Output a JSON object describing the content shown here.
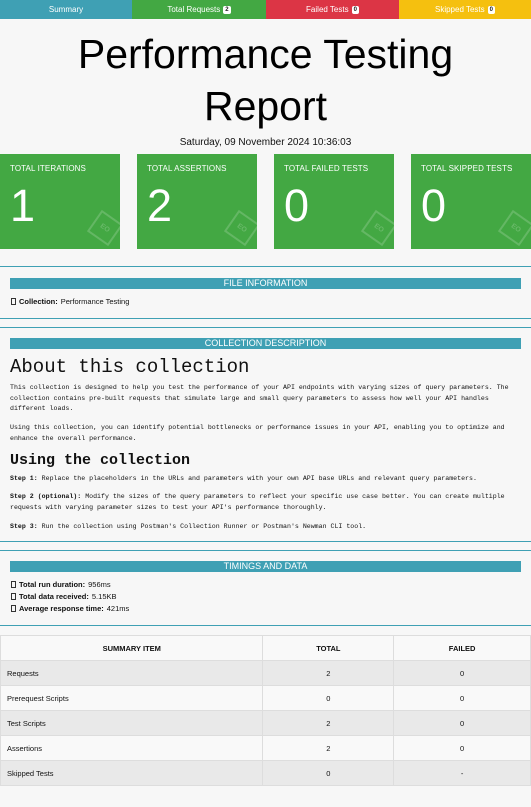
{
  "tabs": [
    {
      "label": "Summary",
      "badge": ""
    },
    {
      "label": "Total Requests",
      "badge": "2"
    },
    {
      "label": "Failed Tests",
      "badge": "0"
    },
    {
      "label": "Skipped Tests",
      "badge": "0"
    }
  ],
  "report": {
    "title_line1": "Performance Testing",
    "title_line2": "Report",
    "datetime": "Saturday, 09 November 2024 10:36:03"
  },
  "cards": [
    {
      "label": "TOTAL ITERATIONS",
      "value": "1",
      "mark": "EO"
    },
    {
      "label": "TOTAL ASSERTIONS",
      "value": "2",
      "mark": "EO"
    },
    {
      "label": "TOTAL FAILED TESTS",
      "value": "0",
      "mark": "EO"
    },
    {
      "label": "TOTAL SKIPPED TESTS",
      "value": "0",
      "mark": "EO"
    }
  ],
  "file_info": {
    "heading": "FILE INFORMATION",
    "collection_label": "Collection:",
    "collection_value": "Performance Testing"
  },
  "description": {
    "heading": "COLLECTION DESCRIPTION",
    "about_title": "About this collection",
    "about_p1": "This collection is designed to help you test the performance of your API endpoints with varying sizes of query parameters. The collection contains pre-built requests that simulate large and small query parameters to assess how well your API handles different loads.",
    "about_p2": "Using this collection, you can identify potential bottlenecks or performance issues in your API, enabling you to optimize and enhance the overall performance.",
    "using_title": "Using the collection",
    "step1_label": "Step 1:",
    "step1_text": " Replace the placeholders in the URLs and parameters with your own API base URLs and relevant query parameters.",
    "step2_label": "Step 2 (optional):",
    "step2_text": " Modify the sizes of the query parameters to reflect your specific use case better. You can create multiple requests with varying parameter sizes to test your API's performance thoroughly.",
    "step3_label": "Step 3:",
    "step3_text": " Run the collection using Postman's Collection Runner or Postman's Newman CLI tool."
  },
  "timings": {
    "heading": "TIMINGS AND DATA",
    "items": [
      {
        "label": "Total run duration:",
        "value": "956ms"
      },
      {
        "label": "Total data received:",
        "value": "5.15KB"
      },
      {
        "label": "Average response time:",
        "value": "421ms"
      }
    ]
  },
  "summary_table": {
    "headers": [
      "SUMMARY ITEM",
      "TOTAL",
      "FAILED"
    ],
    "rows": [
      [
        "Requests",
        "2",
        "0"
      ],
      [
        "Prerequest Scripts",
        "0",
        "0"
      ],
      [
        "Test Scripts",
        "2",
        "0"
      ],
      [
        "Assertions",
        "2",
        "0"
      ],
      [
        "Skipped Tests",
        "0",
        "-"
      ]
    ]
  },
  "colors": {
    "summary": "#3fa0b4",
    "success": "#43a843",
    "failed": "#dc3545",
    "skipped": "#f5c00f"
  }
}
